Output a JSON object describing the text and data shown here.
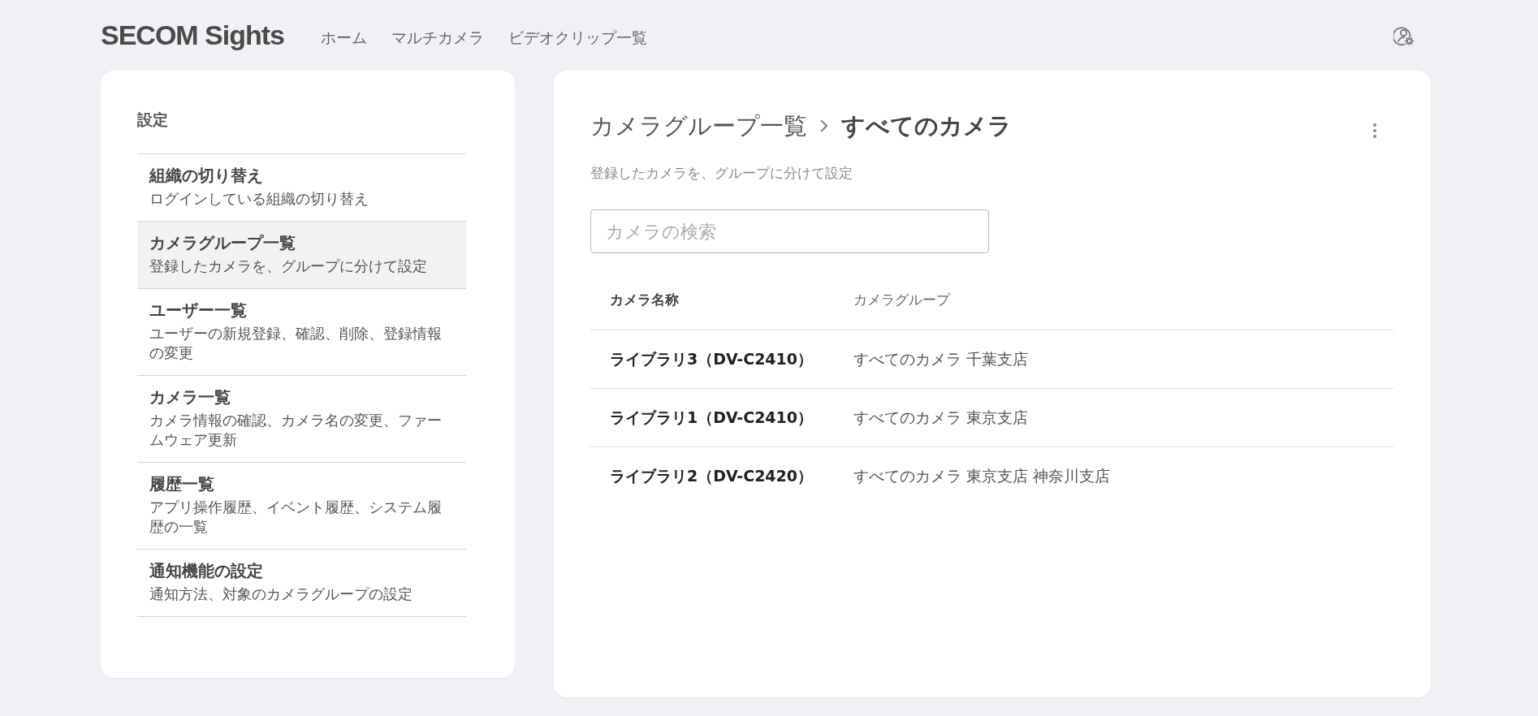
{
  "header": {
    "logo": "SECOM Sights",
    "nav": [
      {
        "label": "ホーム"
      },
      {
        "label": "マルチカメラ"
      },
      {
        "label": "ビデオクリップ一覧"
      }
    ]
  },
  "sidebar": {
    "title": "設定",
    "items": [
      {
        "title": "組織の切り替え",
        "description": "ログインしている組織の切り替え",
        "selected": false
      },
      {
        "title": "カメラグループ一覧",
        "description": "登録したカメラを、グループに分けて設定",
        "selected": true
      },
      {
        "title": "ユーザー一覧",
        "description": "ユーザーの新規登録、確認、削除、登録情報の変更",
        "selected": false
      },
      {
        "title": "カメラ一覧",
        "description": "カメラ情報の確認、カメラ名の変更、ファームウェア更新",
        "selected": false
      },
      {
        "title": "履歴一覧",
        "description": "アプリ操作履歴、イベント履歴、システム履歴の一覧",
        "selected": false
      },
      {
        "title": "通知機能の設定",
        "description": "通知方法、対象のカメラグループの設定",
        "selected": false
      }
    ]
  },
  "main": {
    "breadcrumb": [
      {
        "label": "カメラグループ一覧",
        "current": false
      },
      {
        "label": "すべてのカメラ",
        "current": true
      }
    ],
    "description": "登録したカメラを、グループに分けて設定",
    "search": {
      "placeholder": "カメラの検索"
    },
    "table": {
      "columns": [
        {
          "label": "カメラ名称",
          "sorted": true
        },
        {
          "label": "カメラグループ",
          "sorted": false
        }
      ],
      "rows": [
        {
          "name": "ライブラリ3（DV-C2410）",
          "group": "すべてのカメラ 千葉支店"
        },
        {
          "name": "ライブラリ1（DV-C2410）",
          "group": "すべてのカメラ 東京支店"
        },
        {
          "name": "ライブラリ2（DV-C2420）",
          "group": "すべてのカメラ 東京支店 神奈川支店"
        }
      ]
    }
  }
}
